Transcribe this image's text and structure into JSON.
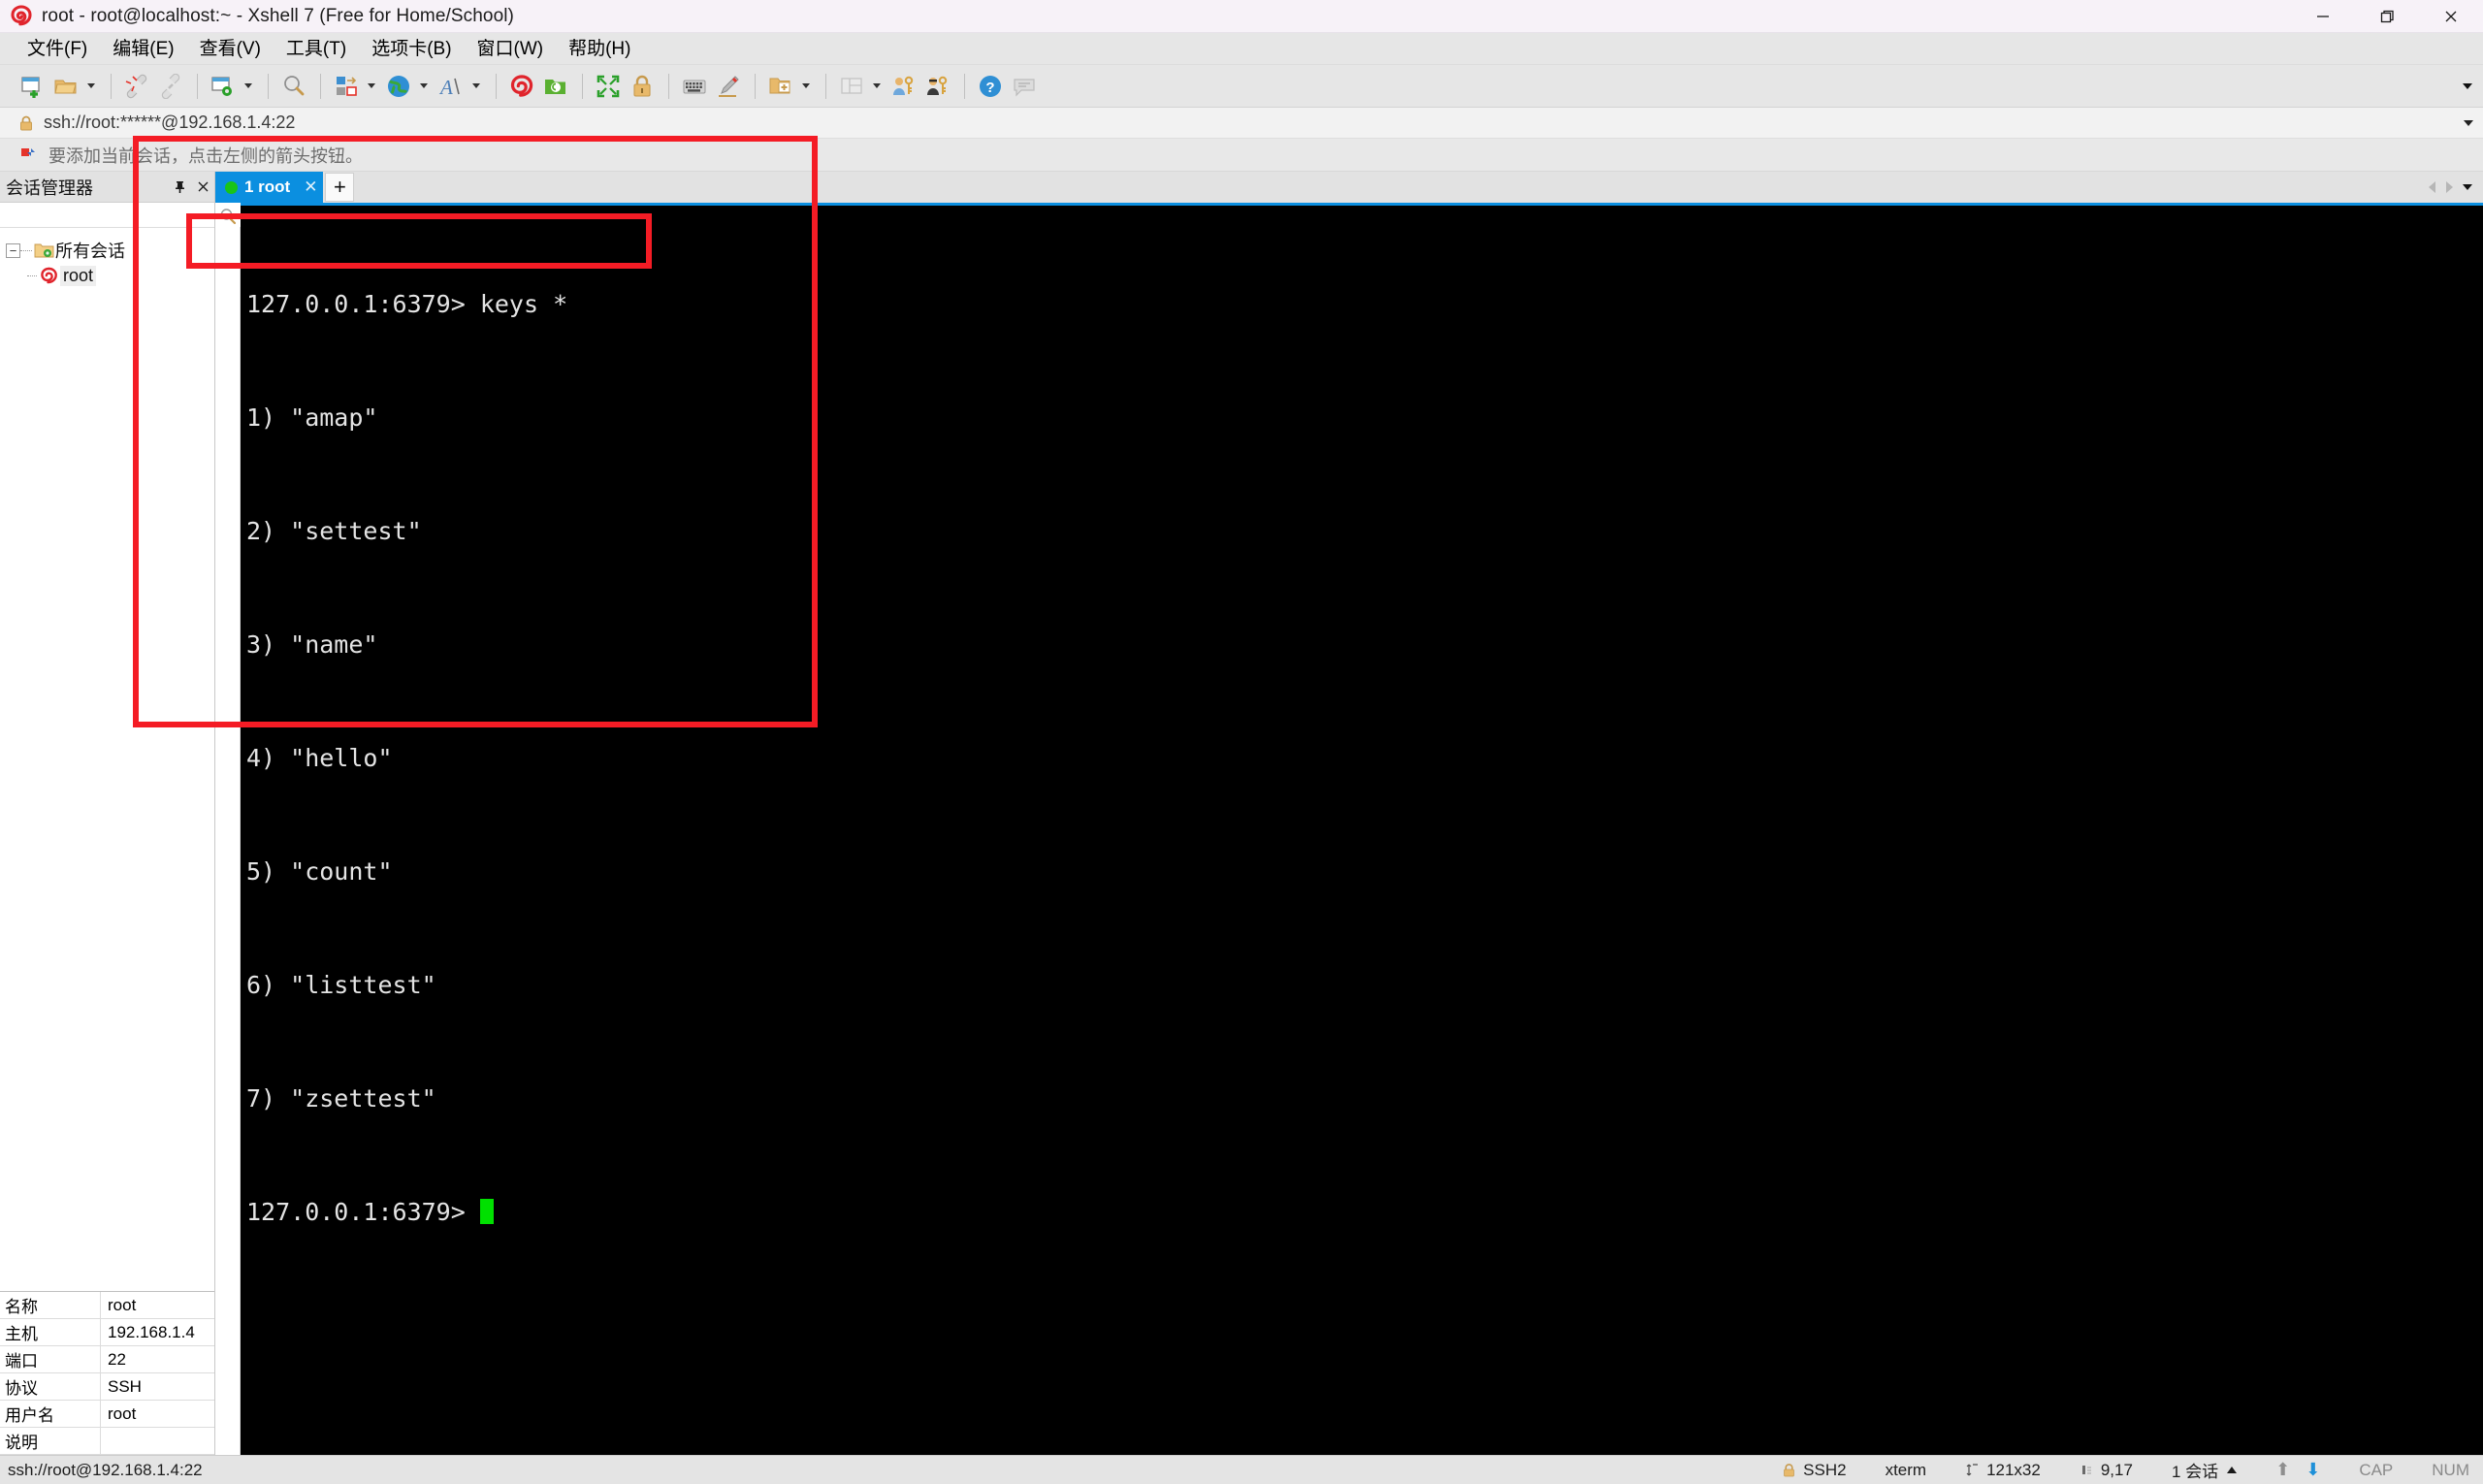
{
  "window": {
    "title": "root - root@localhost:~ - Xshell 7 (Free for Home/School)",
    "app_icon": "xshell-spiral-icon",
    "minimize": "—",
    "maximize": "❐",
    "close": "✕"
  },
  "menubar": {
    "items": [
      {
        "label": "文件(F)",
        "name": "menu-file"
      },
      {
        "label": "编辑(E)",
        "name": "menu-edit"
      },
      {
        "label": "查看(V)",
        "name": "menu-view"
      },
      {
        "label": "工具(T)",
        "name": "menu-tools"
      },
      {
        "label": "选项卡(B)",
        "name": "menu-tabs"
      },
      {
        "label": "窗口(W)",
        "name": "menu-window"
      },
      {
        "label": "帮助(H)",
        "name": "menu-help"
      }
    ]
  },
  "toolbar": {
    "icons": [
      "new-session-icon",
      "open-folder-icon",
      "disconnect-icon",
      "reconnect-icon",
      "session-properties-icon",
      "find-icon",
      "layout-transfer-icon",
      "globe-icon",
      "font-icon",
      "xshell-icon",
      "xftp-icon",
      "fullscreen-icon",
      "lock-icon",
      "keyboard-icon",
      "highlight-icon",
      "new-folder-icon",
      "split-view-icon",
      "user-key-icon",
      "admin-key-icon",
      "help-icon",
      "comment-icon"
    ],
    "overflow": "toolbar-overflow-caret"
  },
  "addressbar": {
    "value": "ssh://root:******@192.168.1.4:22",
    "lock_icon": "lock-icon",
    "dropdown": "address-dropdown-caret"
  },
  "hintbar": {
    "text": "要添加当前会话，点击左侧的箭头按钮。",
    "icon": "arrow-flag-icon"
  },
  "sidebar": {
    "title": "会话管理器",
    "pin_icon": "pin-icon",
    "close_icon": "close-icon",
    "tree": {
      "root": {
        "label": "所有会话",
        "icon": "folder-sessions-icon",
        "toggle": "−"
      },
      "children": [
        {
          "label": "root",
          "icon": "xshell-session-icon",
          "selected": true
        }
      ]
    },
    "properties": [
      {
        "key": "名称",
        "value": "root"
      },
      {
        "key": "主机",
        "value": "192.168.1.4"
      },
      {
        "key": "端口",
        "value": "22"
      },
      {
        "key": "协议",
        "value": "SSH"
      },
      {
        "key": "用户名",
        "value": "root"
      },
      {
        "key": "说明",
        "value": ""
      }
    ]
  },
  "tabstrip": {
    "tabs": [
      {
        "label": "1 root",
        "status": "connected",
        "close": "✕"
      }
    ],
    "add_label": "+",
    "scroll_left": "tab-scroll-left-icon",
    "scroll_right": "tab-scroll-right-icon",
    "tab_menu": "tab-list-caret"
  },
  "terminal": {
    "find_icon": "find-icon",
    "prompt": "127.0.0.1:6379>",
    "lines": [
      "127.0.0.1:6379> keys *",
      "1) \"amap\"",
      "2) \"settest\"",
      "3) \"name\"",
      "4) \"hello\"",
      "5) \"count\"",
      "6) \"listtest\"",
      "7) \"zsettest\""
    ],
    "last_prompt": "127.0.0.1:6379> ",
    "cursor": "block-cursor"
  },
  "statusbar": {
    "left": "ssh://root@192.168.1.4:22",
    "protocol": "SSH2",
    "protocol_icon": "lock-icon",
    "terminal_type": "xterm",
    "size": "121x32",
    "size_icon": "resize-icon",
    "cursor_pos": "9,17",
    "cursor_icon": "cursor-icon",
    "sessions": "1 会话",
    "sessions_caret": "sessions-caret-icon",
    "upload_icon": "upload-arrow-icon",
    "download_icon": "download-arrow-icon",
    "caps": "CAP",
    "num": "NUM"
  },
  "annotations": {
    "outer_box": "highlight-rectangle-terminal",
    "inner_box": "highlight-rectangle-command",
    "color": "#f41c25"
  }
}
